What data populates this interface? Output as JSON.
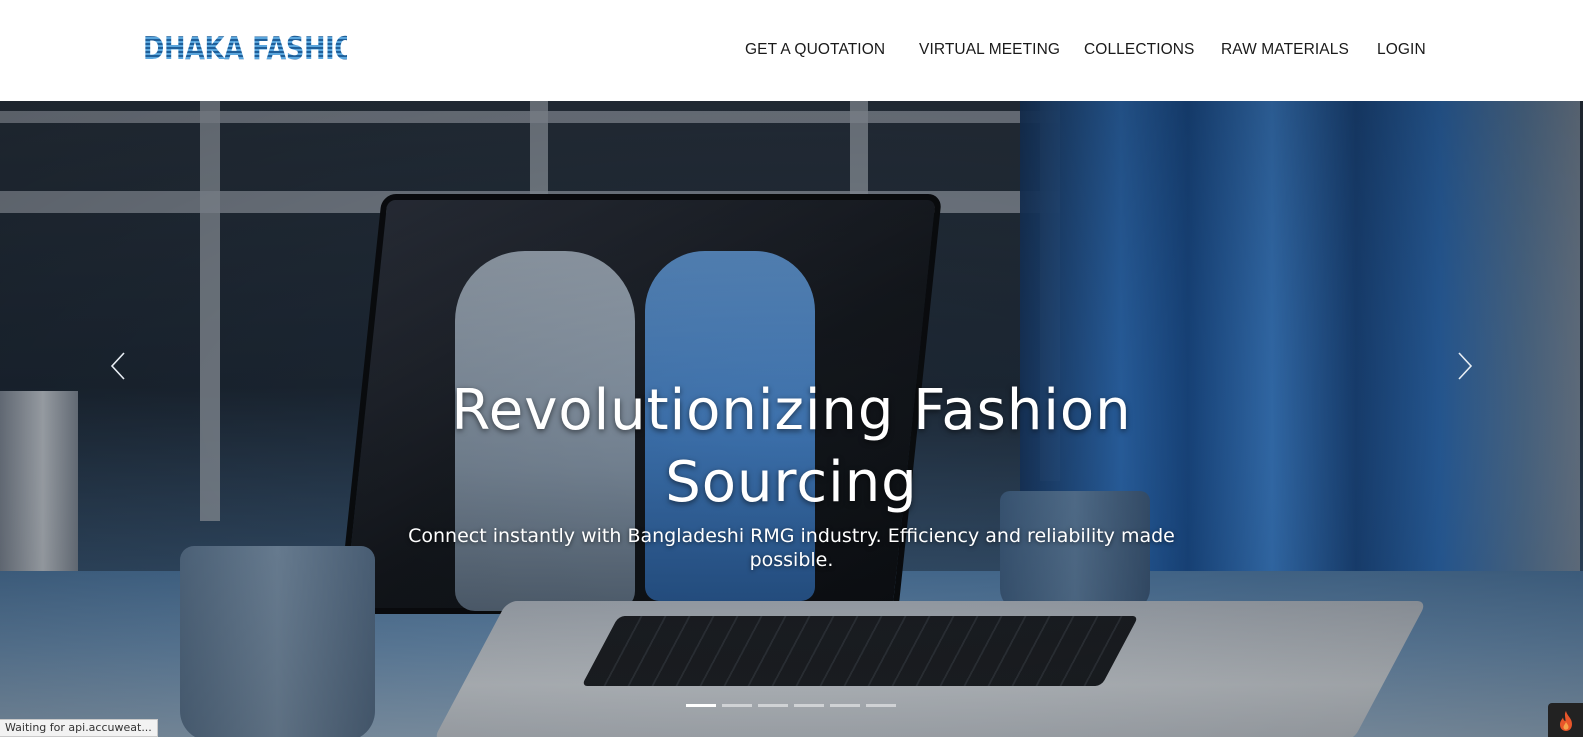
{
  "header": {
    "logo_text": "DHAKA FASHIONS",
    "nav": [
      {
        "label": "GET A QUOTATION"
      },
      {
        "label": "VIRTUAL MEETING"
      },
      {
        "label": "COLLECTIONS"
      },
      {
        "label": "RAW MATERIALS"
      },
      {
        "label": "LOGIN"
      }
    ]
  },
  "hero": {
    "title": "Revolutionizing Fashion Sourcing",
    "subtitle": "Connect instantly with Bangladeshi RMG industry. Efficiency and reliability made possible.",
    "prev_icon": "chevron-left-icon",
    "next_icon": "chevron-right-icon",
    "slide_count": 6,
    "active_slide": 1
  },
  "status_bar": {
    "text": "Waiting for api.accuweat..."
  },
  "floating_button": {
    "icon": "flame-icon",
    "color": "#e8562a"
  },
  "colors": {
    "logo_blue": "#2e75b6",
    "nav_text": "#1a1a1a",
    "hero_text": "#ffffff"
  }
}
